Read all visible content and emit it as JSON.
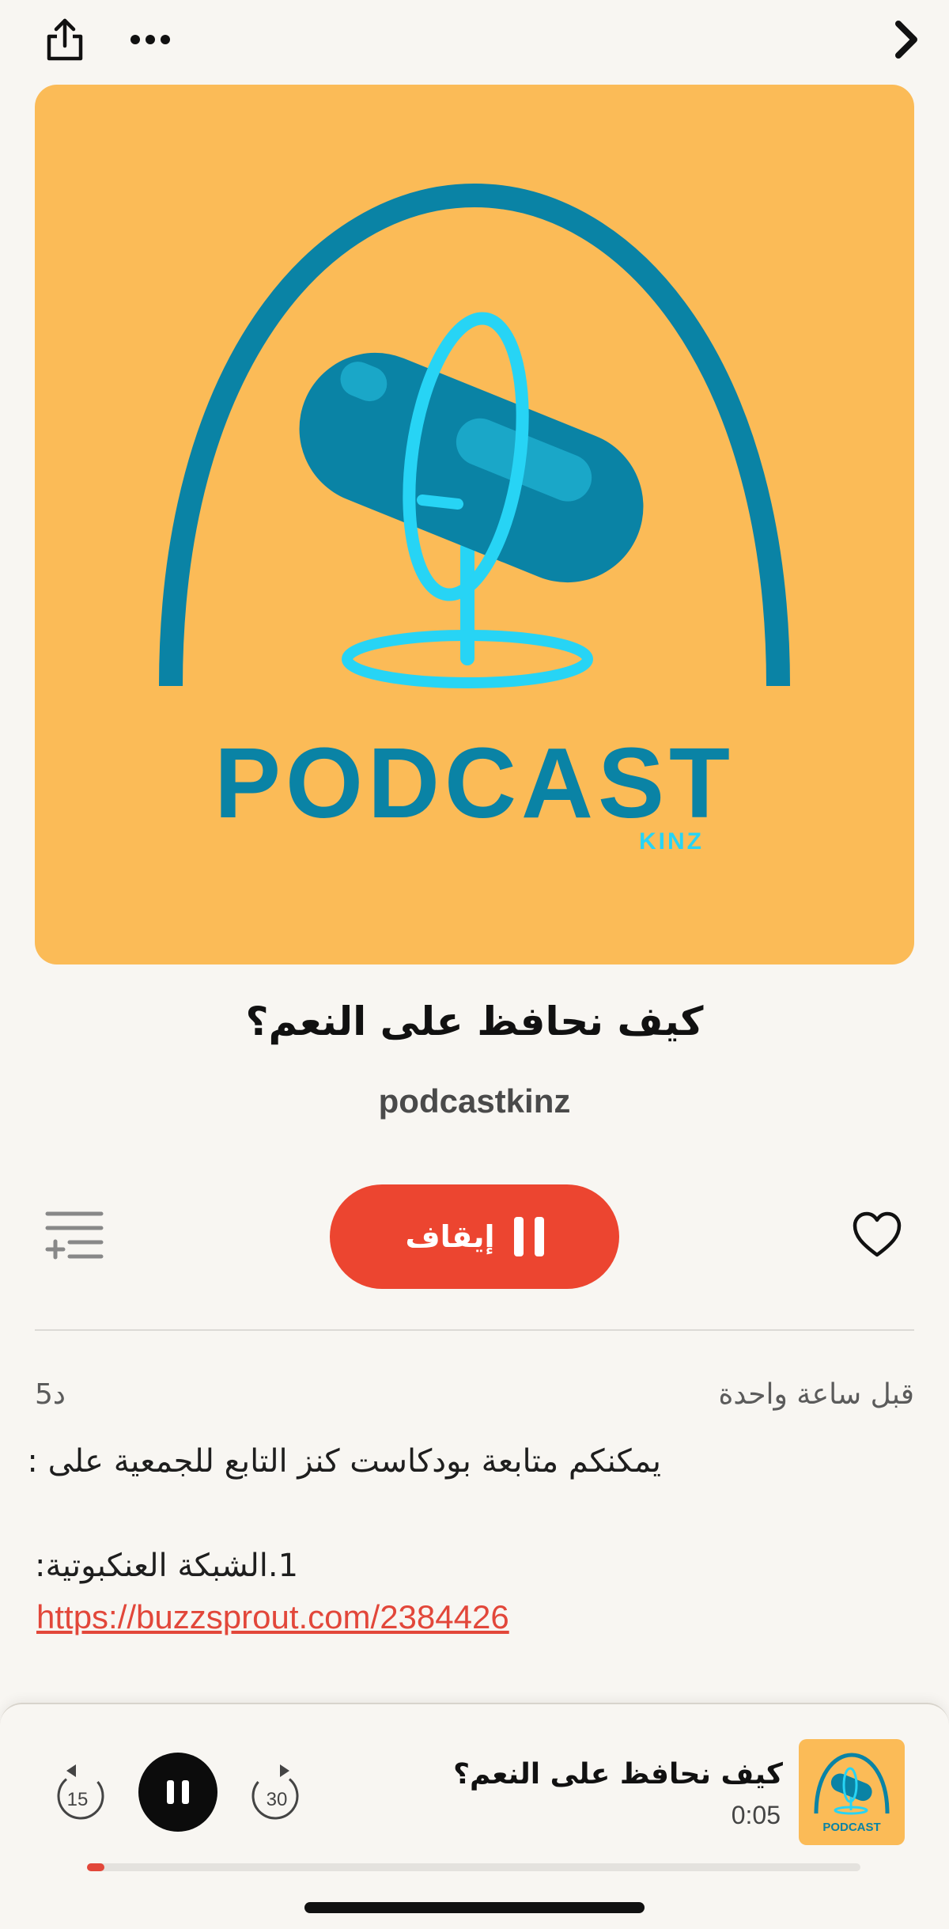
{
  "topbar": {
    "share_icon": "share-icon",
    "more_icon": "more-icon",
    "next_icon": "chevron-right-icon"
  },
  "artwork": {
    "brand_text": "PODCAST",
    "brand_sub": "KINZ",
    "background_color": "#fbbb57",
    "primary_color": "#0a83a5",
    "accent_color": "#27d4f5"
  },
  "episode": {
    "title": "كيف نحافظ على النعم؟",
    "show": "podcastkinz"
  },
  "controls": {
    "queue_icon": "add-to-queue-icon",
    "pause_label": "إيقاف",
    "heart_icon": "heart-icon",
    "accent": "#ec4530"
  },
  "details": {
    "time_ago": "قبل ساعة واحدة",
    "duration": "5د",
    "description_line1": "يمكنكم متابعة بودكاست كنز التابع للجمعية على :",
    "description_line2": "1.الشبكة العنكبوتية:",
    "link": "https://buzzsprout.com/2384426"
  },
  "mini_player": {
    "title": "كيف نحافظ على النعم؟",
    "elapsed": "0:05",
    "skip_back": "15",
    "skip_forward": "30",
    "progress_fraction": 0.015,
    "art_text": "PODCAST"
  }
}
